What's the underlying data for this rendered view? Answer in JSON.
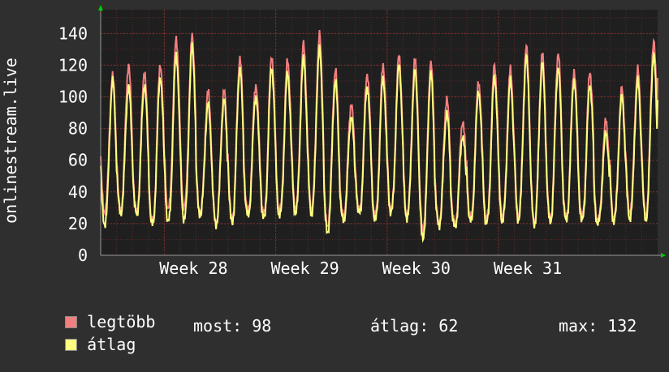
{
  "colors": {
    "background": "#2f2f2f",
    "plot_bg": "#1f1f1f",
    "grid": "#5a2a2a",
    "text": "#ffffff",
    "max_series": "#f27f7f",
    "avg_series": "#ffff80",
    "axis_arrow": "#00cc00"
  },
  "legend": {
    "max_label": "legtöbb",
    "avg_label": "átlag"
  },
  "stats": {
    "current": "most: 98",
    "average": "átlag: 62",
    "maximum": "max: 132"
  },
  "chart_data": {
    "type": "line",
    "ylabel": "onlinestream.live",
    "ylim": [
      0,
      155
    ],
    "yticks": [
      0,
      20,
      40,
      60,
      80,
      100,
      120,
      140
    ],
    "x_range": [
      0,
      35
    ],
    "xticks": [
      {
        "label": "Week 28",
        "x": 4
      },
      {
        "label": "Week 29",
        "x": 11
      },
      {
        "label": "Week 30",
        "x": 18
      },
      {
        "label": "Week 31",
        "x": 25
      }
    ],
    "grid": true,
    "day_start": 0.25,
    "day_peaks_max": [
      113,
      120,
      116,
      121,
      137,
      138,
      103,
      104,
      125,
      108,
      126,
      123,
      133,
      139,
      117,
      96,
      115,
      120,
      126,
      123,
      121,
      99,
      85,
      110,
      120,
      117,
      131,
      127,
      128,
      117,
      116,
      85,
      105,
      117,
      135
    ],
    "day_troughs_max": [
      28,
      29,
      28,
      21,
      29,
      31,
      27,
      21,
      23,
      28,
      26,
      28,
      30,
      30,
      19,
      25,
      28,
      25,
      29,
      26,
      17,
      21,
      20,
      24,
      23,
      25,
      26,
      22,
      23,
      24,
      25,
      22,
      24,
      28,
      26
    ],
    "day_peaks_avg": [
      110,
      107,
      108,
      113,
      127,
      132,
      95,
      98,
      118,
      101,
      119,
      115,
      124,
      130,
      110,
      88,
      107,
      112,
      120,
      116,
      115,
      90,
      76,
      104,
      113,
      110,
      125,
      121,
      119,
      111,
      108,
      77,
      100,
      110,
      127
    ],
    "day_troughs_avg": [
      20,
      27,
      26,
      19,
      21,
      23,
      26,
      20,
      21,
      25,
      23,
      25,
      27,
      27,
      15,
      22,
      26,
      22,
      27,
      24,
      12,
      19,
      18,
      21,
      20,
      22,
      23,
      20,
      21,
      22,
      22,
      20,
      22,
      24,
      23
    ],
    "last_value": 98,
    "series": [
      {
        "name": "legtöbb",
        "key": "max"
      },
      {
        "name": "átlag",
        "key": "avg"
      }
    ]
  }
}
